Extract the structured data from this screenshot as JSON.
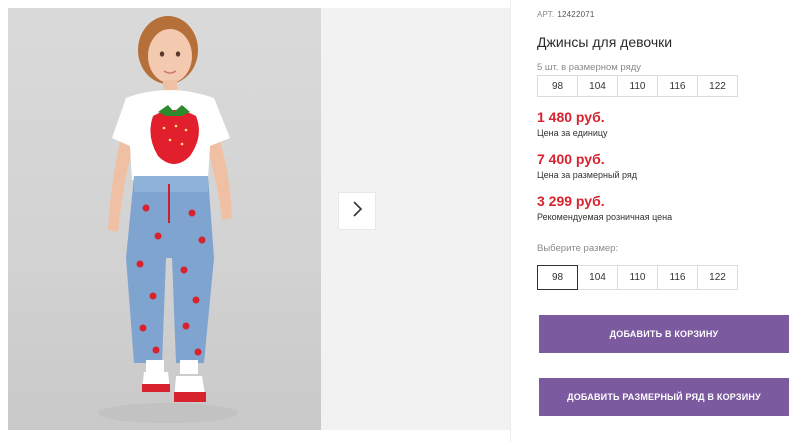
{
  "product": {
    "sku_label": "АРТ.",
    "sku": "12422071",
    "title": "Джинсы для девочки",
    "pack_label": "5 шт. в размерном ряду",
    "pack_sizes": [
      "98",
      "104",
      "110",
      "116",
      "122"
    ]
  },
  "prices": [
    {
      "value": "1 480 руб.",
      "note": "Цена за единицу"
    },
    {
      "value": "7 400 руб.",
      "note": "Цена за размерный ряд"
    },
    {
      "value": "3 299 руб.",
      "note": "Рекомендуемая розничная цена"
    }
  ],
  "size_picker": {
    "label": "Выберите размер:",
    "sizes": [
      "98",
      "104",
      "110",
      "116",
      "122"
    ],
    "selected": "98"
  },
  "actions": {
    "add_to_cart": "ДОБАВИТЬ В КОРЗИНУ",
    "add_pack_to_cart": "ДОБАВИТЬ РАЗМЕРНЫЙ РЯД В КОРЗИНУ"
  },
  "colors": {
    "price": "#d8222e",
    "button": "#7b5aa0"
  },
  "icons": {
    "next": "chevron-right-icon"
  }
}
